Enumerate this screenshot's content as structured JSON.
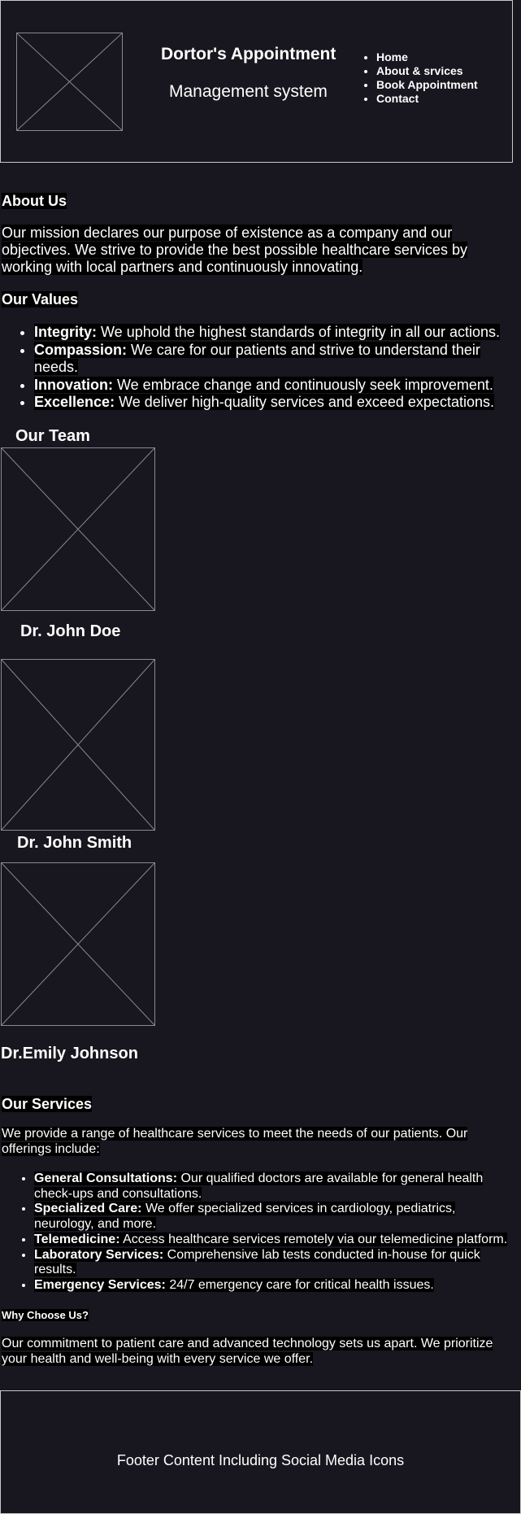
{
  "header": {
    "title": "Dortor's Appointment",
    "subtitle": "Management system",
    "nav": [
      "Home",
      "About & srvices",
      "Book Appointment",
      "Contact"
    ]
  },
  "about": {
    "heading": "About Us",
    "text": "Our mission declares our purpose of existence as a company and our objectives. We strive to provide the best possible healthcare services by working with local partners and continuously innovating."
  },
  "values": {
    "heading": "Our Values",
    "items": [
      {
        "term": "Integrity:",
        "desc": " We uphold the highest standards of integrity in all our actions."
      },
      {
        "term": "Compassion:",
        "desc": " We care for our patients and strive to understand their needs."
      },
      {
        "term": "Innovation:",
        "desc": " We embrace change and continuously seek improvement."
      },
      {
        "term": "Excellence:",
        "desc": " We deliver high-quality services and exceed expectations."
      }
    ]
  },
  "team": {
    "heading": "Our Team",
    "members": [
      "Dr. John Doe",
      "Dr. John Smith",
      "Dr.Emily Johnson"
    ]
  },
  "services": {
    "heading": "Our Services",
    "intro": "We provide a range of healthcare services to meet the needs of our patients. Our offerings include:",
    "items": [
      {
        "term": "General Consultations:",
        "desc": " Our qualified doctors are available for general health check-ups and consultations."
      },
      {
        "term": "Specialized Care:",
        "desc": " We offer specialized services in cardiology, pediatrics, neurology, and more."
      },
      {
        "term": "Telemedicine:",
        "desc": " Access healthcare services remotely via our telemedicine platform."
      },
      {
        "term": "Laboratory Services:",
        "desc": " Comprehensive lab tests conducted in-house for quick results."
      },
      {
        "term": "Emergency Services:",
        "desc": " 24/7 emergency care for critical health issues."
      }
    ]
  },
  "why": {
    "heading": "Why Choose Us?",
    "text": "Our commitment to patient care and advanced technology sets us apart. We prioritize your health and well-being with every service we offer."
  },
  "footer": {
    "text": "Footer Content Including Social Media Icons"
  }
}
